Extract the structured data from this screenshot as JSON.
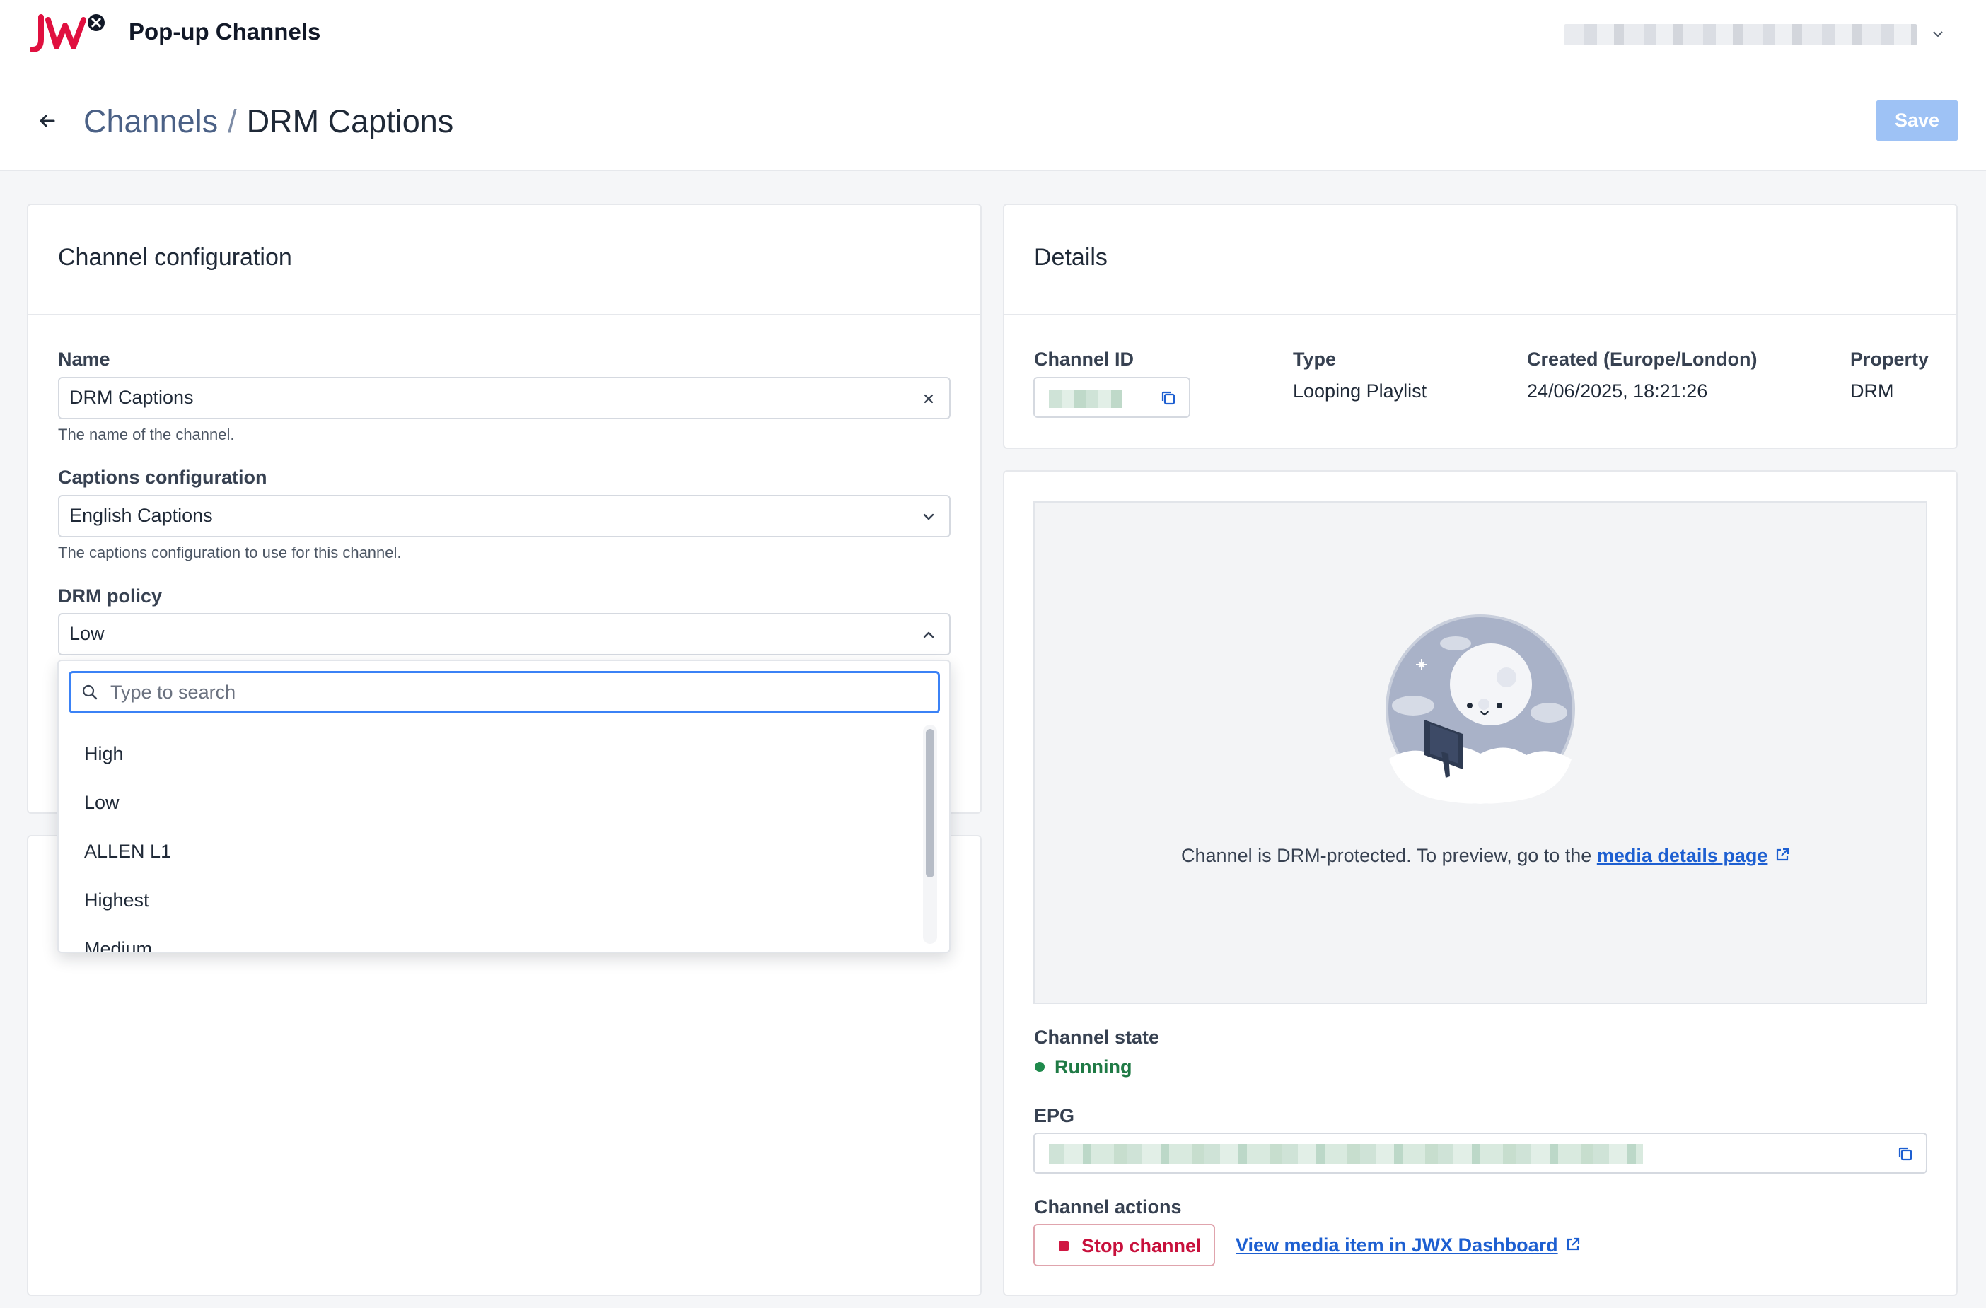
{
  "header": {
    "app_name": "Pop-up Channels"
  },
  "breadcrumb": {
    "parent": "Channels",
    "separator": "/",
    "current": "DRM Captions"
  },
  "toolbar": {
    "save_label": "Save"
  },
  "config": {
    "title": "Channel configuration",
    "name": {
      "label": "Name",
      "value": "DRM Captions",
      "help": "The name of the channel."
    },
    "captions": {
      "label": "Captions configuration",
      "value": "English Captions",
      "help": "The captions configuration to use for this channel."
    },
    "drm": {
      "label": "DRM policy",
      "value": "Low",
      "search_placeholder": "Type to search",
      "options": [
        "High",
        "Low",
        "ALLEN L1",
        "Highest",
        "Medium"
      ]
    }
  },
  "details": {
    "title": "Details",
    "channel_id_label": "Channel ID",
    "type_label": "Type",
    "type_value": "Looping Playlist",
    "created_label": "Created (Europe/London)",
    "created_value": "24/06/2025, 18:21:26",
    "property_label": "Property",
    "property_value": "DRM"
  },
  "preview": {
    "message": "Channel is DRM-protected. To preview, go to the ",
    "link_text": "media details page"
  },
  "state": {
    "label": "Channel state",
    "value": "Running",
    "color": "#1f8a4c"
  },
  "epg": {
    "label": "EPG"
  },
  "actions": {
    "label": "Channel actions",
    "stop_label": "Stop channel",
    "jwx_link": "View media item in JWX Dashboard"
  },
  "colors": {
    "brand": "#e0103f",
    "accent": "#1d5fd1",
    "save_disabled": "#9ec2f5"
  },
  "icons": [
    "jw-logo-icon",
    "chevron-down-icon",
    "arrow-left-icon",
    "close-icon",
    "chevron-up-icon",
    "search-icon",
    "copy-icon",
    "external-link-icon"
  ]
}
